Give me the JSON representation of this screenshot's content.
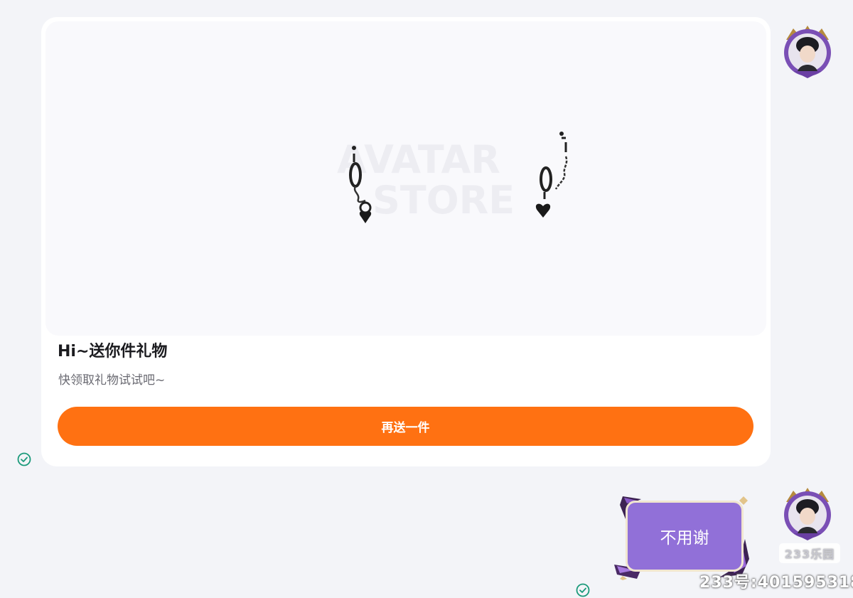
{
  "gift_card": {
    "title": "Hi~送你件礼物",
    "subtitle": "快领取礼物试试吧~",
    "button_label": "再送一件",
    "image_watermark": [
      "AVATAR",
      "STORE"
    ],
    "image_icon": "earring-chains-item-image"
  },
  "reply_message": {
    "text": "不用谢"
  },
  "status_icons": [
    "check-circle-icon",
    "check-circle-icon"
  ],
  "watermarks": {
    "brand": "233乐园",
    "id_text": "233号:401595318"
  },
  "colors": {
    "background": "#f3f4f8",
    "button": "#ff7112",
    "bubble": "#9170d8",
    "check": "#1a9a7a"
  }
}
